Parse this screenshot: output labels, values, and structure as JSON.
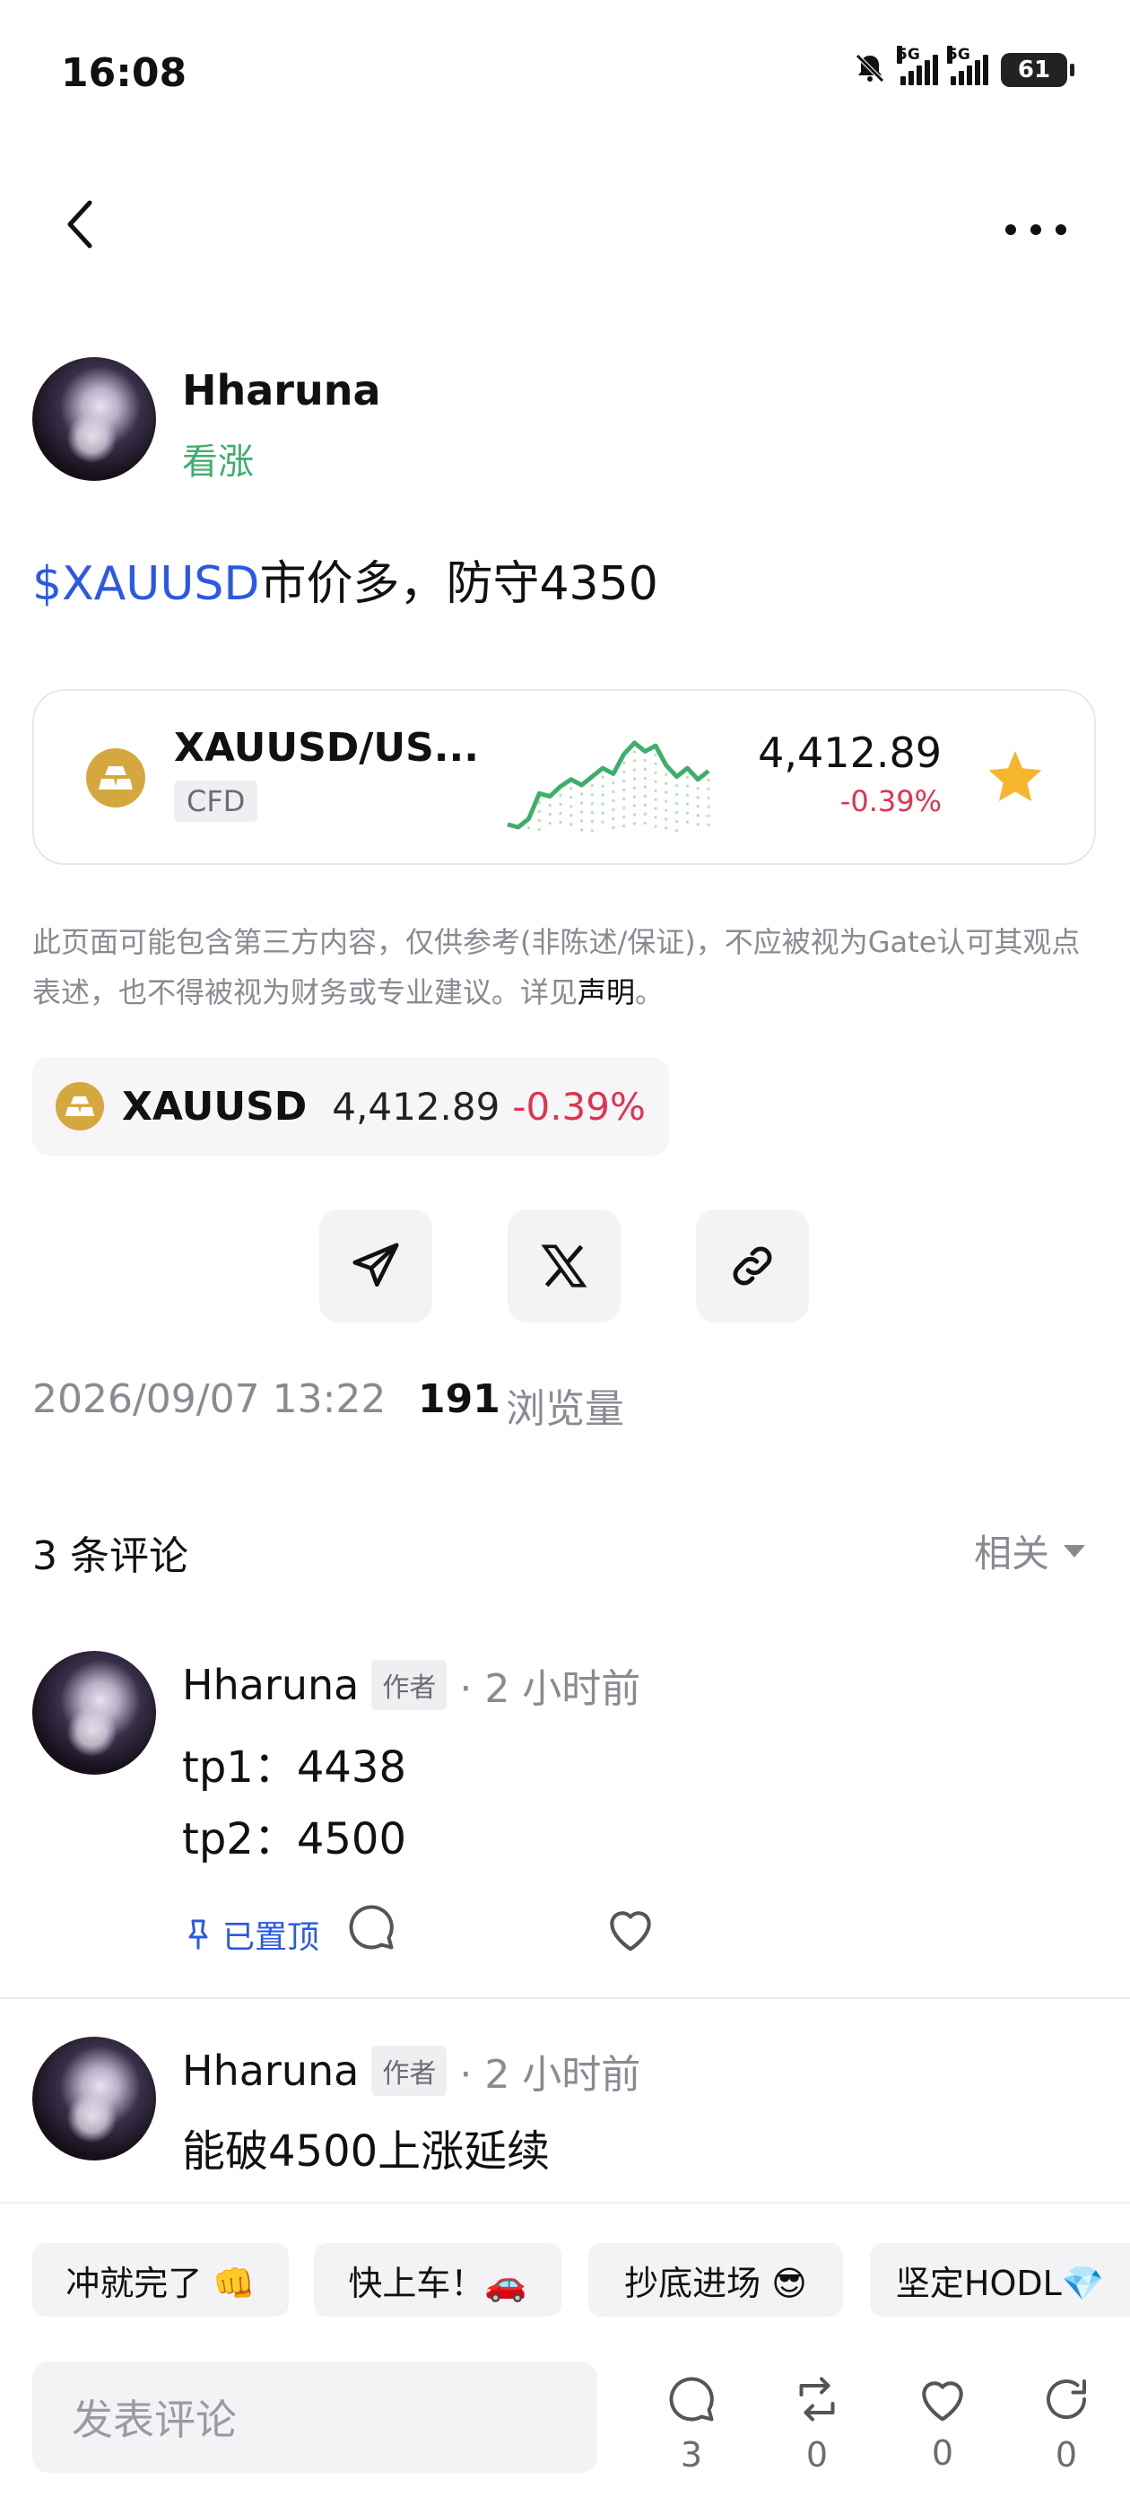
{
  "status_bar": {
    "time": "16:08",
    "network1": "5G",
    "network2": "5G",
    "battery": "61"
  },
  "post": {
    "author": "Hharuna",
    "sentiment": "看涨",
    "ticker": "$XAUUSD",
    "text": "市价多，防守4350"
  },
  "market_card": {
    "symbol": "XAUUSD/US...",
    "type": "CFD",
    "price": "4,412.89",
    "change": "-0.39%",
    "sparkline": [
      8,
      6,
      12,
      30,
      28,
      35,
      40,
      36,
      42,
      48,
      44,
      58,
      66,
      60,
      64,
      50,
      42,
      48,
      40,
      46
    ]
  },
  "disclaimer": {
    "text": "此页面可能包含第三方内容，仅供参考(非陈述/保证)，不应被视为Gate认可其观点表述，也不得被视为财务或专业建议。详见",
    "link": "声明",
    "end": "。"
  },
  "ticker_chip": {
    "symbol": "XAUUSD",
    "price": "4,412.89",
    "change": "-0.39%"
  },
  "meta": {
    "datetime": "2026/09/07 13:22",
    "views": "191",
    "views_label": "浏览量"
  },
  "comments": {
    "count_label": "3 条评论",
    "sort_label": "相关",
    "items": [
      {
        "author": "Hharuna",
        "badge": "作者",
        "time": "· 2 小时前",
        "line1": "tp1：4438",
        "line2": "tp2：4500",
        "pinned": "已置顶"
      },
      {
        "author": "Hharuna",
        "badge": "作者",
        "time": "· 2 小时前",
        "line1": "能破4500上涨延续"
      }
    ]
  },
  "quick_replies": [
    "冲就完了 👊",
    "快上车！🚗",
    "抄底进场 😎",
    "坚定HODL💎"
  ],
  "composer": {
    "placeholder": "发表评论",
    "comment_count": "3",
    "repost_count": "0",
    "like_count": "0",
    "share_count": "0"
  }
}
